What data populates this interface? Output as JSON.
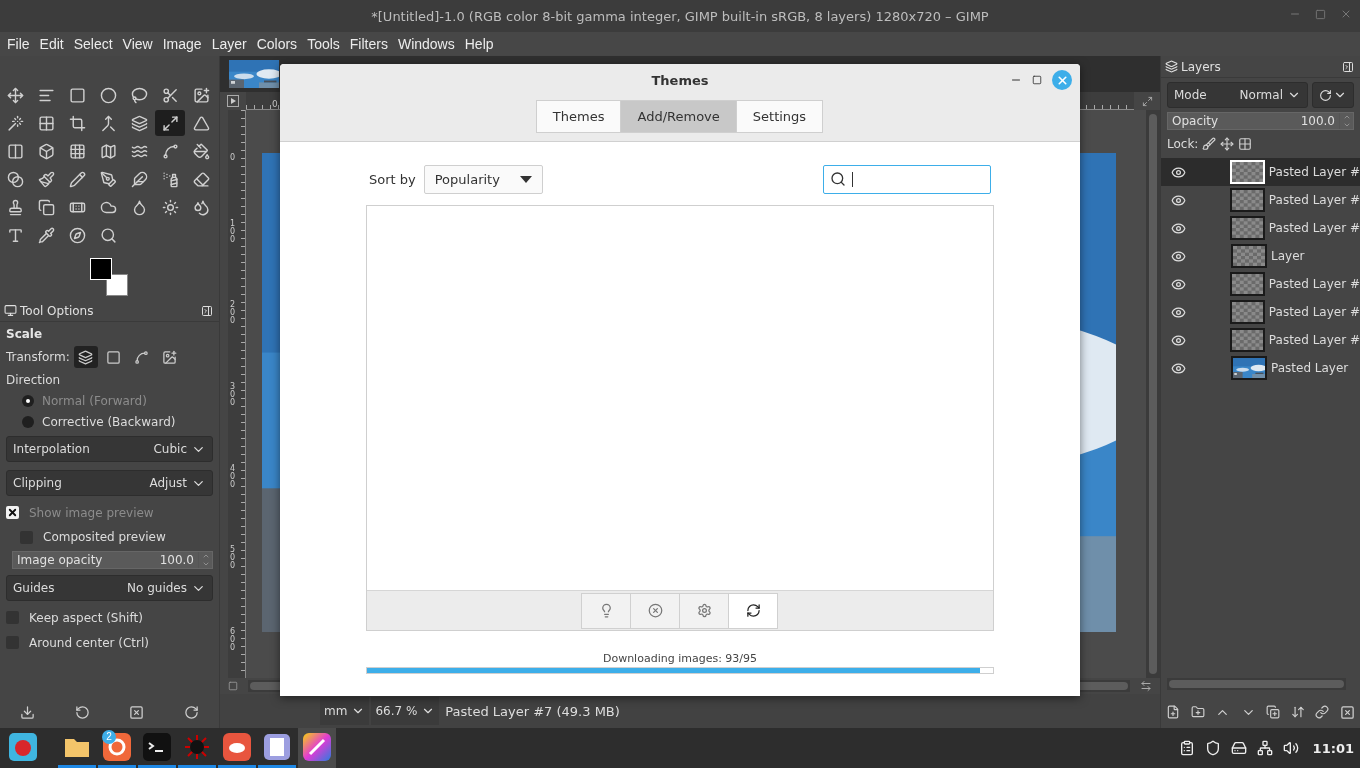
{
  "window": {
    "title": "*[Untitled]-1.0 (RGB color 8-bit gamma integer, GIMP built-in sRGB, 8 layers) 1280x720 – GIMP"
  },
  "menu": [
    "File",
    "Edit",
    "Select",
    "View",
    "Image",
    "Layer",
    "Colors",
    "Tools",
    "Filters",
    "Windows",
    "Help"
  ],
  "toolbox": {
    "tools": [
      {
        "selected": false
      },
      {
        "selected": false
      },
      {
        "selected": false
      },
      {
        "selected": false
      },
      {
        "selected": false
      },
      {
        "selected": false
      },
      {
        "selected": false
      },
      {
        "selected": false
      },
      {
        "selected": false
      },
      {
        "selected": false
      },
      {
        "selected": false
      },
      {
        "selected": false
      },
      {
        "selected": true
      },
      {
        "selected": false
      },
      {
        "selected": false
      },
      {
        "selected": false
      },
      {
        "selected": false
      },
      {
        "selected": false
      },
      {
        "selected": false
      },
      {
        "selected": false
      },
      {
        "selected": false
      },
      {
        "selected": false
      },
      {
        "selected": false
      },
      {
        "selected": false
      },
      {
        "selected": false
      },
      {
        "selected": false
      },
      {
        "selected": false
      },
      {
        "selected": false
      },
      {
        "selected": false
      },
      {
        "selected": false
      },
      {
        "selected": false
      },
      {
        "selected": false
      },
      {
        "selected": false
      },
      {
        "selected": false
      },
      {
        "selected": false
      },
      {
        "selected": false
      },
      {
        "selected": false
      },
      {
        "selected": false
      },
      {
        "selected": false
      }
    ]
  },
  "tool_options": {
    "tab": "Tool Options",
    "tool": "Scale",
    "transform_label": "Transform:",
    "transform_modes": [
      {
        "selected": true
      },
      {
        "selected": false
      },
      {
        "selected": false
      },
      {
        "selected": false
      }
    ],
    "direction_label": "Direction",
    "directions": [
      {
        "label": "Normal (Forward)",
        "selected": true,
        "disabled": true
      },
      {
        "label": "Corrective (Backward)",
        "selected": false,
        "disabled": false
      }
    ],
    "options": [
      {
        "kind": "dropdown",
        "label": "Interpolation",
        "value": "Cubic"
      },
      {
        "kind": "dropdown",
        "label": "Clipping",
        "value": "Adjust"
      },
      {
        "kind": "checkbox",
        "label": "Show image preview",
        "checked": true,
        "disabled": true,
        "children": [
          {
            "kind": "checkbox",
            "label": "Composited preview",
            "checked": false,
            "disabled": false
          },
          {
            "kind": "spin",
            "label": "Image opacity",
            "value": "100.0",
            "level": 1
          }
        ]
      },
      {
        "kind": "dropdown",
        "label": "Guides",
        "value": "No guides"
      },
      {
        "kind": "checkbox",
        "label": "Keep aspect (Shift)",
        "checked": false,
        "disabled": false
      },
      {
        "kind": "checkbox",
        "label": "Around center (Ctrl)",
        "checked": false,
        "disabled": false
      }
    ]
  },
  "canvas": {
    "top_ruler": [
      "0"
    ],
    "left_ruler": [
      "0",
      "100",
      "200",
      "300",
      "400",
      "500",
      "600"
    ]
  },
  "status_bar": {
    "unit": "mm",
    "zoom": "66.7 %",
    "info": "Pasted Layer #7 (49.3 MB)"
  },
  "layers_panel": {
    "tab": "Layers",
    "mode": {
      "label": "Mode",
      "value": "Normal"
    },
    "opacity": {
      "label": "Opacity",
      "value": "100.0",
      "level": 1
    },
    "lock_label": "Lock:",
    "layers": [
      {
        "name": "Pasted Layer #",
        "visible": true,
        "selected": true,
        "kind": "transparent"
      },
      {
        "name": "Pasted Layer #",
        "visible": true,
        "selected": false,
        "kind": "transparent"
      },
      {
        "name": "Pasted Layer #",
        "visible": true,
        "selected": false,
        "kind": "transparent"
      },
      {
        "name": "Layer",
        "visible": true,
        "selected": false,
        "kind": "transparent"
      },
      {
        "name": "Pasted Layer #",
        "visible": true,
        "selected": false,
        "kind": "transparent"
      },
      {
        "name": "Pasted Layer #",
        "visible": true,
        "selected": false,
        "kind": "transparent"
      },
      {
        "name": "Pasted Layer #",
        "visible": true,
        "selected": false,
        "kind": "transparent"
      },
      {
        "name": "Pasted Layer",
        "visible": true,
        "selected": false,
        "kind": "picture"
      }
    ]
  },
  "dialog": {
    "title": "Themes",
    "tabs": [
      {
        "label": "Themes",
        "selected": false
      },
      {
        "label": "Add/Remove",
        "selected": true
      },
      {
        "label": "Settings",
        "selected": false
      }
    ],
    "sort": {
      "label": "Sort by",
      "value": "Popularity"
    },
    "actions": [
      {
        "selected": false
      },
      {
        "selected": false
      },
      {
        "selected": false
      },
      {
        "selected": true
      }
    ],
    "progress": {
      "label": "Downloading images: 93/95",
      "level": 0.979
    }
  },
  "taskbar": {
    "apps": [
      {
        "running": false,
        "active": false
      },
      {
        "running": true,
        "active": false
      },
      {
        "running": true,
        "active": false,
        "badge": "2"
      },
      {
        "running": true,
        "active": false
      },
      {
        "running": true,
        "active": false
      },
      {
        "running": true,
        "active": false
      },
      {
        "running": true,
        "active": false
      },
      {
        "running": false,
        "active": true
      }
    ],
    "clock": "11:01"
  }
}
